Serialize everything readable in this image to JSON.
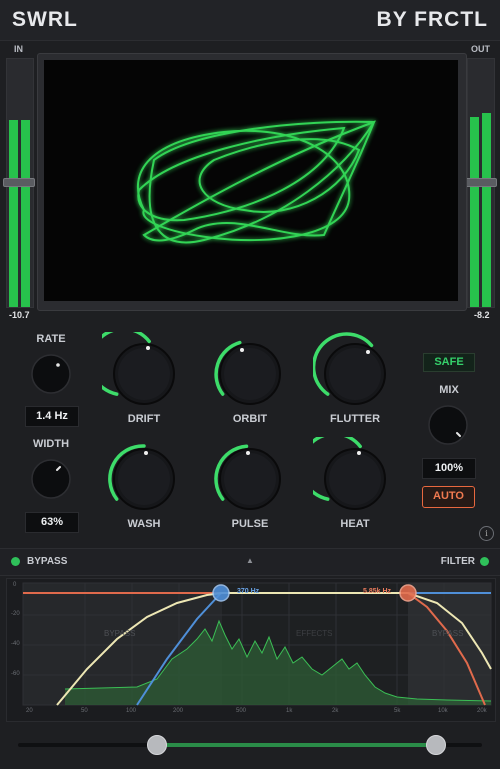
{
  "header": {
    "title": "SWRL",
    "brand": "BY FRCTL"
  },
  "meters": {
    "in": {
      "label": "IN",
      "value": "-10.7",
      "level": 0.76
    },
    "out": {
      "label": "OUT",
      "value": "-8.2",
      "level": 0.79
    }
  },
  "controls": {
    "rate": {
      "label": "RATE",
      "value": "1.4 Hz"
    },
    "width": {
      "label": "WIDTH",
      "value": "63%"
    },
    "mix": {
      "label": "MIX",
      "value": "100%"
    },
    "safe_label": "SAFE",
    "auto_label": "AUTO",
    "info_label": "i",
    "knobs": [
      {
        "label": "DRIFT",
        "amount": 0.55
      },
      {
        "label": "ORBIT",
        "amount": 0.45
      },
      {
        "label": "FLUTTER",
        "amount": 0.6
      },
      {
        "label": "WASH",
        "amount": 0.5
      },
      {
        "label": "PULSE",
        "amount": 0.48
      },
      {
        "label": "HEAT",
        "amount": 0.55
      }
    ]
  },
  "bypass_bar": {
    "left_label": "BYPASS",
    "right_label": "FILTER",
    "arrow": "▲"
  },
  "eq": {
    "zones": {
      "left": "BYPASS",
      "middle": "EFFECTS",
      "right": "BYPASS"
    },
    "low_freq_label": "370 Hz",
    "high_freq_label": "5.85k Hz",
    "y_ticks": [
      "0",
      "-20",
      "-40",
      "-60"
    ],
    "x_ticks": [
      "20",
      "50",
      "100",
      "200",
      "500",
      "1k",
      "2k",
      "5k",
      "10k",
      "20k"
    ],
    "colors": {
      "low": "#4f8fd8",
      "high": "#e06a4c",
      "curve": "#ede7b4",
      "spectrum": "#3bbf55"
    }
  },
  "range_slider": {
    "low": 0.3,
    "high": 0.92
  }
}
